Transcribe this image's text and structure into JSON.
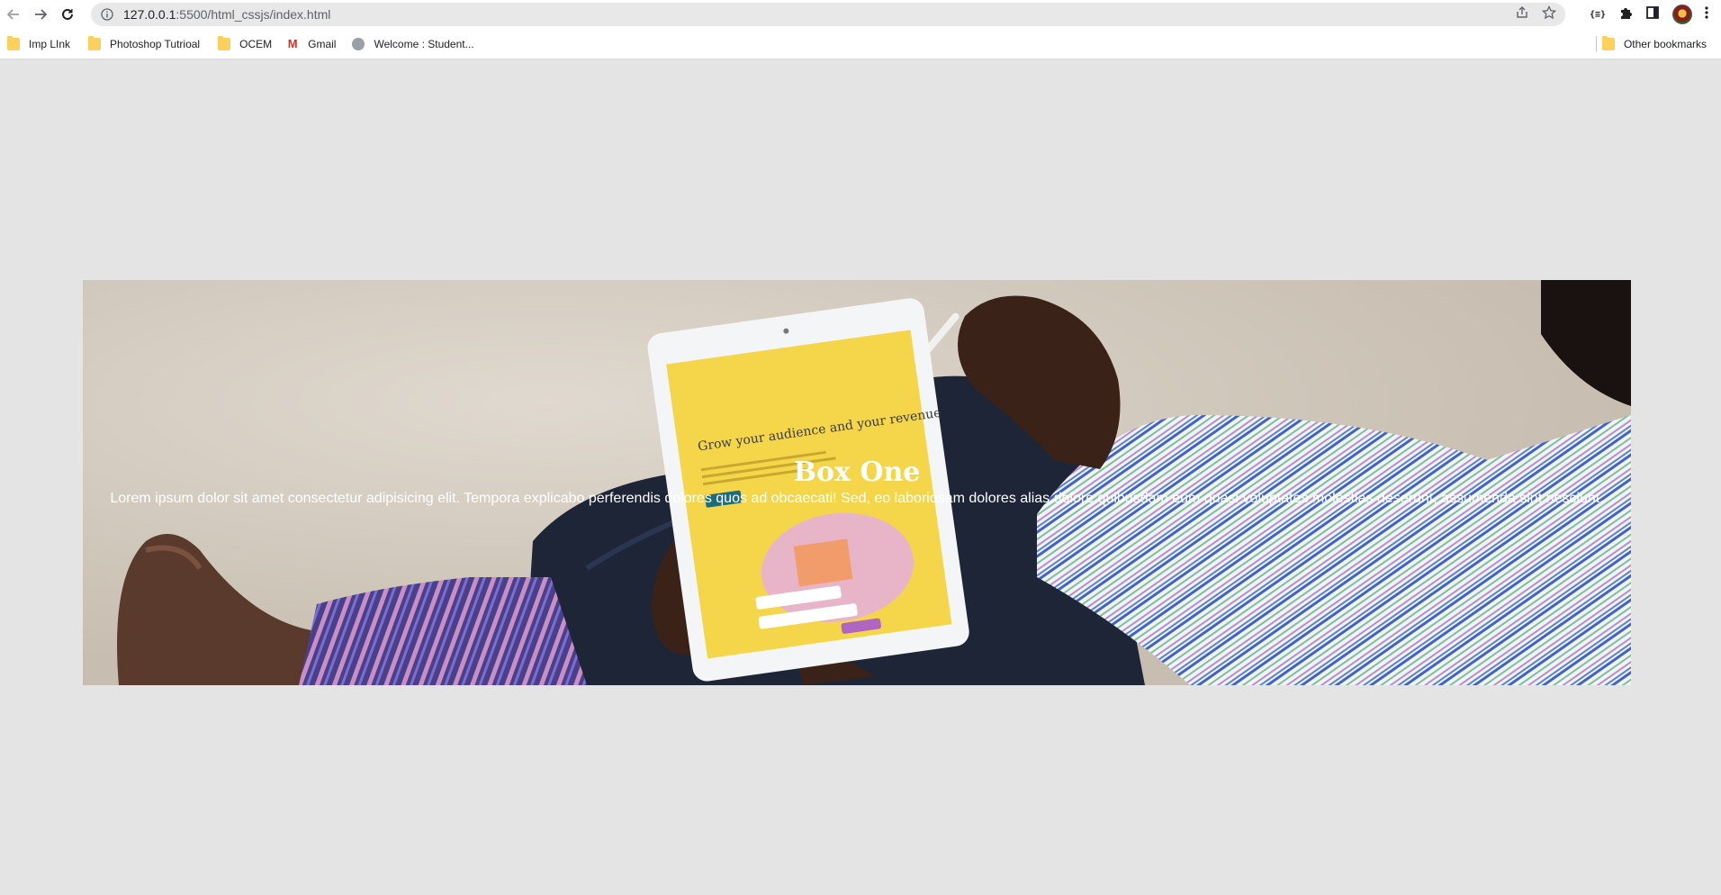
{
  "browser": {
    "url_host": "127.0.0.1",
    "url_rest": ":5500/html_cssjs/index.html",
    "bookmarks": [
      {
        "label": "Imp LInk",
        "icon": "folder-icon"
      },
      {
        "label": "Photoshop Tutrioal",
        "icon": "folder-icon"
      },
      {
        "label": "OCEM",
        "icon": "folder-icon"
      },
      {
        "label": "Gmail",
        "icon": "gmail-icon"
      },
      {
        "label": "Welcome : Student...",
        "icon": "globe-icon"
      }
    ],
    "other_bookmarks": "Other bookmarks"
  },
  "hero": {
    "title": "Box One",
    "text": "Lorem ipsum dolor sit amet consectetur adipisicing elit. Tempora explicabo perferendis dolores quos ad obcaecati! Sed, eo laboriosam dolores alias dolore quibusdam eum quasi voluptates molestias deserunt, assumenda sint nesciunt.",
    "tablet_heading": "Grow your audience and your revenue"
  },
  "colors": {
    "page_background": "#e4e4e4",
    "tablet_screen": "#f5d64a",
    "shirt_stripe_blue": "#3e63c9"
  }
}
